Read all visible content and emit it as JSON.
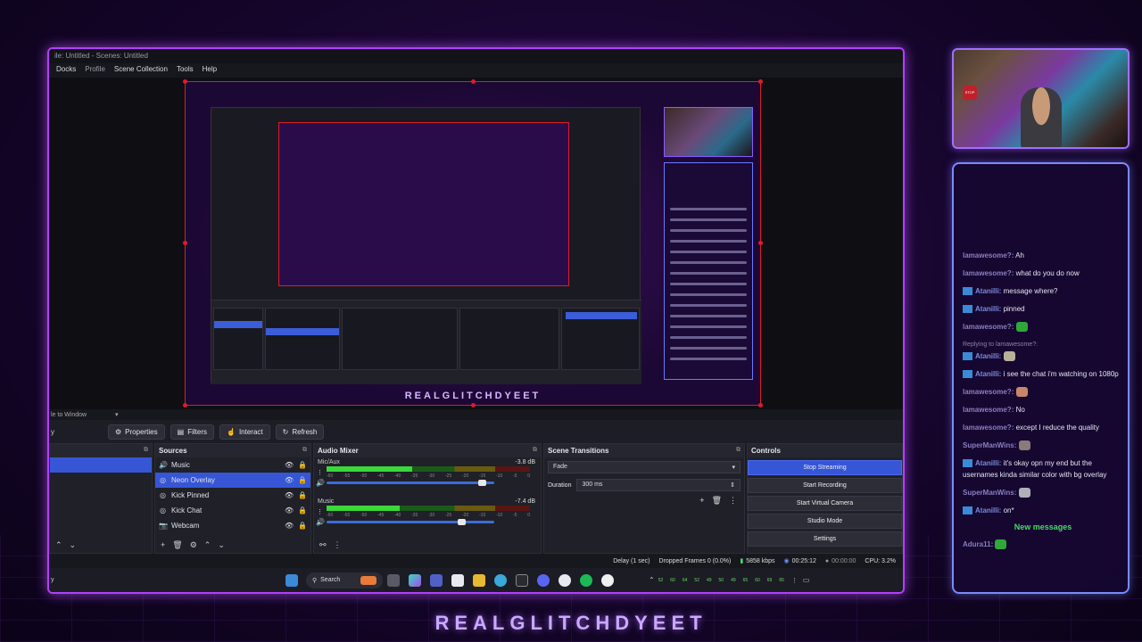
{
  "app": {
    "title": "ile: Untitled - Scenes: Untitled",
    "menu": [
      "Docks",
      "Profile",
      "Scene Collection",
      "Tools",
      "Help"
    ]
  },
  "preview": {
    "brand_text": "REALGLITCHDYEET"
  },
  "scale_label": "le to Window",
  "toolbar": {
    "left_label": "y",
    "properties": "Properties",
    "filters": "Filters",
    "interact": "Interact",
    "refresh": "Refresh"
  },
  "sources": {
    "title": "Sources",
    "items": [
      {
        "name": "Music",
        "icon": "speaker-icon",
        "selected": false
      },
      {
        "name": "Neon Overlay",
        "icon": "globe-icon",
        "selected": true
      },
      {
        "name": "Kick Pinned",
        "icon": "globe-icon",
        "selected": false
      },
      {
        "name": "Kick Chat",
        "icon": "globe-icon",
        "selected": false
      },
      {
        "name": "Webcam",
        "icon": "camera-icon",
        "selected": false
      }
    ]
  },
  "mixer": {
    "title": "Audio Mixer",
    "ticks": [
      "-60",
      "-55",
      "-50",
      "-45",
      "-40",
      "-35",
      "-30",
      "-25",
      "-20",
      "-15",
      "-10",
      "-5",
      "0"
    ],
    "channels": [
      {
        "name": "Mic/Aux",
        "db": "-3.8 dB",
        "level": 0.42,
        "volume": 0.95
      },
      {
        "name": "Music",
        "db": "-7.4 dB",
        "level": 0.36,
        "volume": 0.83
      }
    ]
  },
  "transitions": {
    "title": "Scene Transitions",
    "type": "Fade",
    "duration_label": "Duration",
    "duration_value": "300 ms"
  },
  "controls": {
    "title": "Controls",
    "buttons": [
      "Stop Streaming",
      "Start Recording",
      "Start Virtual Camera",
      "Studio Mode",
      "Settings"
    ]
  },
  "status": {
    "delay": "Delay (1 sec)",
    "dropped": "Dropped Frames 0 (0.0%)",
    "bitrate": "5858 kbps",
    "stream_time": "00:25:12",
    "rec_time": "00:00:00",
    "cpu": "CPU: 3.2%"
  },
  "taskbar": {
    "search": "Search",
    "tray_numbers": [
      "52",
      "60",
      "64",
      "52",
      "49",
      "50",
      "49",
      "65",
      "60",
      "69",
      "65"
    ],
    "bottom_left": "y"
  },
  "chat": {
    "messages": [
      {
        "user": "lamawesome?:",
        "text": "Ah",
        "mod": false
      },
      {
        "user": "lamawesome?:",
        "text": "what do you do now",
        "mod": false
      },
      {
        "user": "Atanilli:",
        "text": "message where?",
        "mod": true
      },
      {
        "user": "Atanilli:",
        "text": "pinned",
        "mod": true
      },
      {
        "user": "lamawesome?:",
        "text": "",
        "mod": false,
        "emote": "#2fa83a"
      },
      {
        "reply": "Replying to lamawesome?:",
        "user": "Atanilli:",
        "text": "",
        "mod": true,
        "emote": "#b9b09a"
      },
      {
        "user": "Atanilli:",
        "text": "i see the chat i'm watching on 1080p",
        "mod": true
      },
      {
        "user": "lamawesome?:",
        "text": "",
        "mod": false,
        "emote": "#c9856a"
      },
      {
        "user": "lamawesome?:",
        "text": "No",
        "mod": false
      },
      {
        "user": "lamawesome?:",
        "text": "except I reduce the quality",
        "mod": false
      },
      {
        "user": "SuperManWins:",
        "text": "",
        "mod": false,
        "emote": "#8a7a7a"
      },
      {
        "user": "Atanilli:",
        "text": "it's okay opn my end but the usernames kinda similar color with bg overlay",
        "mod": true
      },
      {
        "user": "SuperManWins:",
        "text": "",
        "mod": false,
        "emote": "#b0b0b8"
      },
      {
        "user": "Atanilli:",
        "text": "on*",
        "mod": true
      }
    ],
    "new_messages": "New messages",
    "last": {
      "user": "Adura11:",
      "emote": "#2fa83a"
    }
  },
  "brand": "REALGLITCHDYEET",
  "colors": {
    "accent": "#b040ff",
    "selection": "#3656d6",
    "live_red": "#e11a2a",
    "chat_border": "#7a8aff"
  }
}
